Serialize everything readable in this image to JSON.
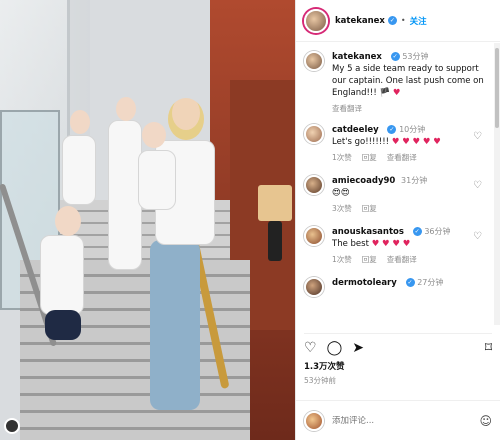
{
  "post": {
    "username": "katekanex",
    "follow_label": "关注",
    "caption_time": "53分钟",
    "caption": "My 5 a side team ready to support our captain. One last push come on England!!!",
    "caption_emojis": "🏴 ♥",
    "translate_label": "查看翻译",
    "likes": "1.3万次赞",
    "posted_ago": "53分钟前",
    "add_comment_placeholder": "添加评论..."
  },
  "comments": [
    {
      "user": "catdeeley",
      "time": "10分钟",
      "text": "Let's go!!!!!!!",
      "emojis": "♥ ♥ ♥ ♥ ♥",
      "likes": "1次赞",
      "reply": "回复",
      "translate": "查看翻译"
    },
    {
      "user": "amiecoady90",
      "time": "31分钟",
      "text": "",
      "emojis": "😍😍",
      "likes": "3次赞",
      "reply": "回复",
      "translate": ""
    },
    {
      "user": "anouskasantos",
      "time": "36分钟",
      "text": "The best",
      "emojis": "♥ ♥ ♥ ♥",
      "likes": "1次赞",
      "reply": "回复",
      "translate": "查看翻译"
    },
    {
      "user": "dermotoleary",
      "time": "27分钟",
      "text": "",
      "emojis": "",
      "likes": "",
      "reply": "",
      "translate": ""
    }
  ],
  "colors": {
    "accent": "#0095f6",
    "verified": "#3897f0",
    "heart": "#e0245e"
  }
}
